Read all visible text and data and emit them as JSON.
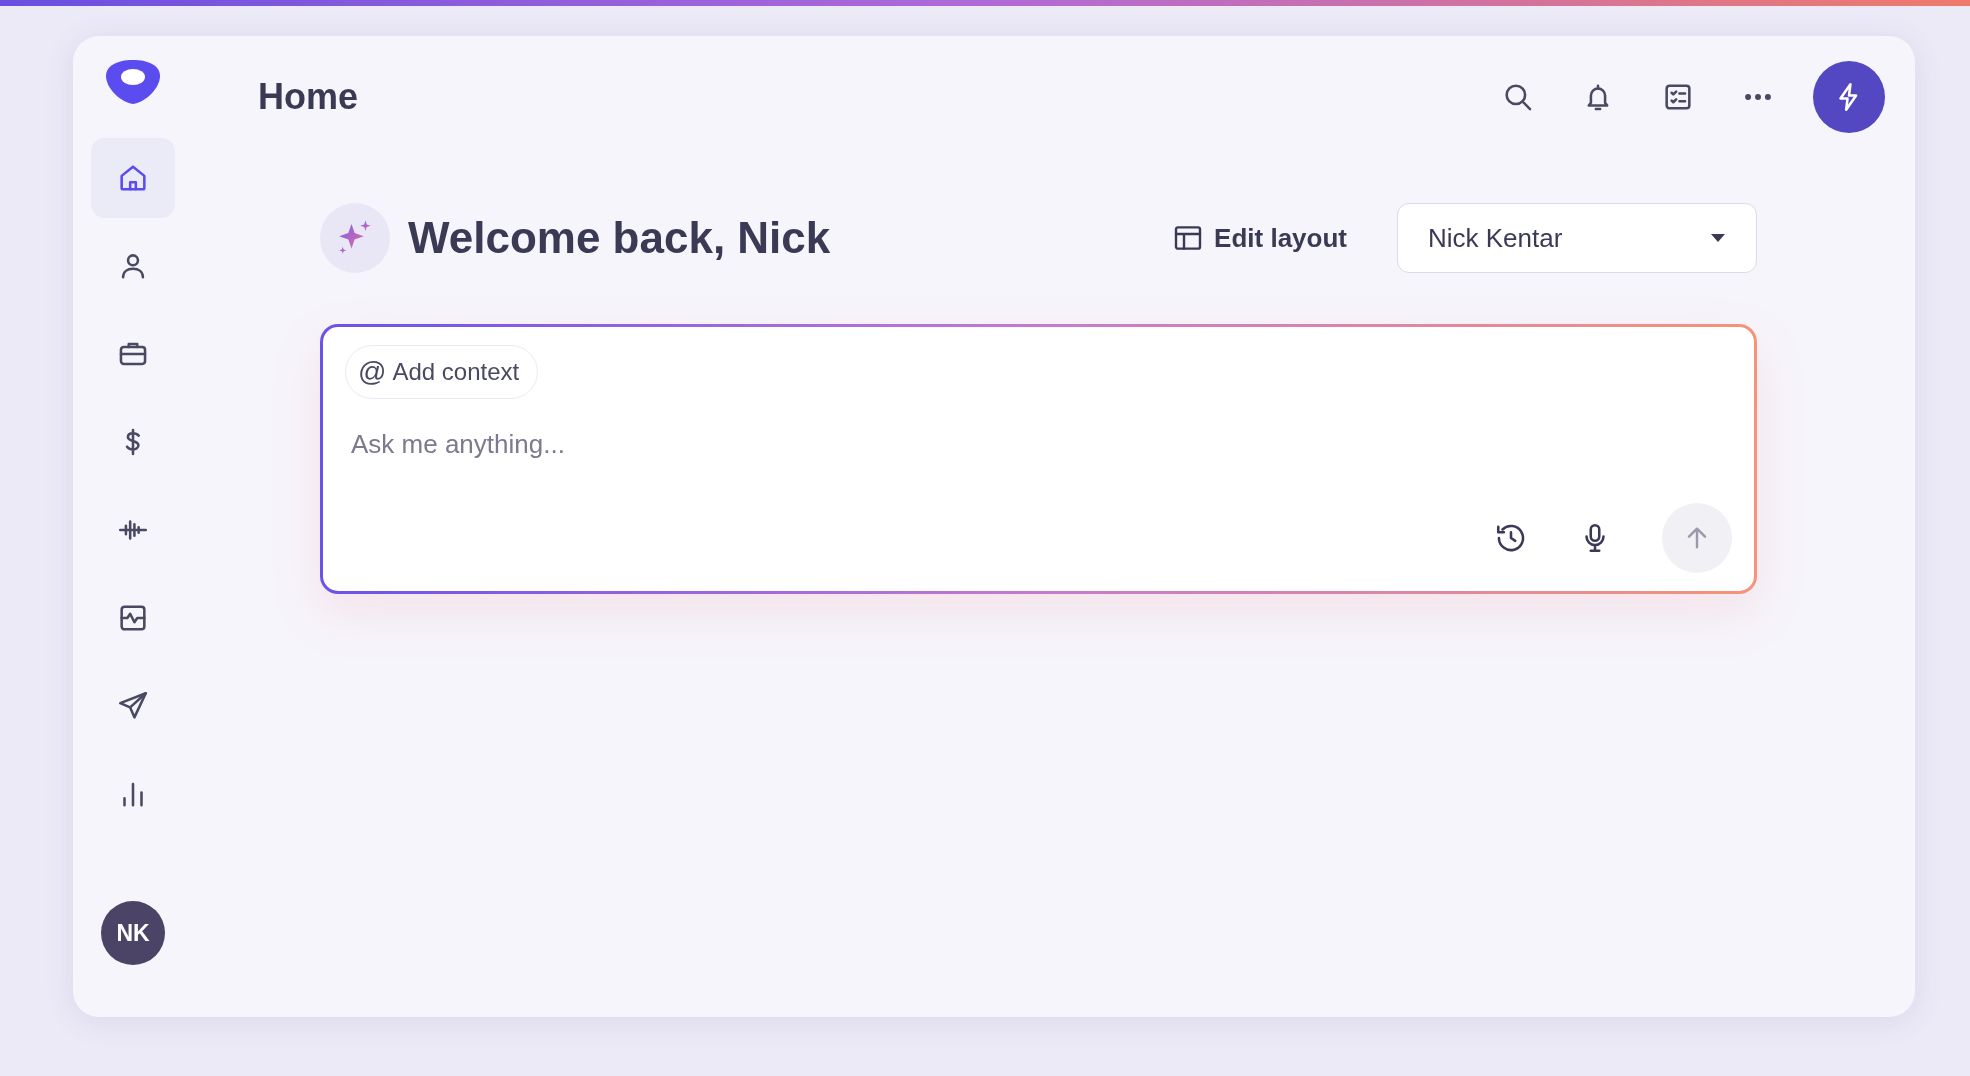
{
  "header": {
    "title": "Home"
  },
  "sidebar": {
    "items": [
      {
        "kind": "home",
        "selected": true
      },
      {
        "kind": "person",
        "selected": false
      },
      {
        "kind": "briefcase",
        "selected": false
      },
      {
        "kind": "dollar",
        "selected": false
      },
      {
        "kind": "waveform",
        "selected": false
      },
      {
        "kind": "pulse",
        "selected": false
      },
      {
        "kind": "send",
        "selected": false
      },
      {
        "kind": "chart",
        "selected": false
      }
    ],
    "avatar": "NK"
  },
  "welcome": {
    "title": "Welcome back, Nick",
    "edit_layout": "Edit layout",
    "user_select": "Nick Kentar"
  },
  "prompt": {
    "context_chip": "@",
    "context_label": "Add context",
    "placeholder": "Ask me anything..."
  }
}
